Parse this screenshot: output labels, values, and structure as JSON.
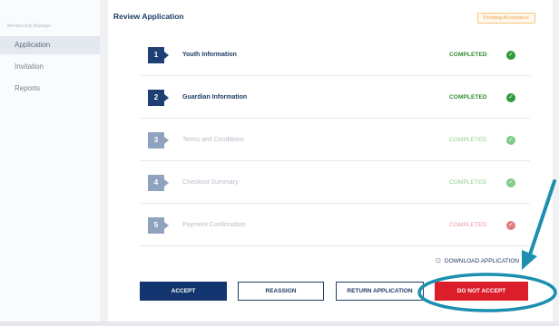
{
  "sidebar": {
    "title": "Membership Manager",
    "items": [
      {
        "label": "Application",
        "active": true
      },
      {
        "label": "Invitation",
        "active": false
      },
      {
        "label": "Reports",
        "active": false
      }
    ]
  },
  "header": {
    "title": "Review Application",
    "badge": "Pending Acceptance"
  },
  "steps": [
    {
      "number": "1",
      "label": "Youth Information",
      "status": "COMPLETED",
      "state": "active"
    },
    {
      "number": "2",
      "label": "Guardian Information",
      "status": "COMPLETED",
      "state": "active"
    },
    {
      "number": "3",
      "label": "Terms and Conditions",
      "status": "COMPLETED",
      "state": "faded"
    },
    {
      "number": "4",
      "label": "Checkout Summary",
      "status": "COMPLETED",
      "state": "faded"
    },
    {
      "number": "5",
      "label": "Payment Confirmation",
      "status": "COMPLETED",
      "state": "faded-error"
    }
  ],
  "download": {
    "label": "DOWNLOAD APPLICATION",
    "icon": "download-icon"
  },
  "actions": {
    "accept": "ACCEPT",
    "reassign": "REASSIGN",
    "return": "RETURN APPLICATION",
    "do_not_accept": "DO NOT ACCEPT"
  },
  "colors": {
    "navy": "#12356f",
    "step_active": "#1d3f73",
    "step_faded": "#8fa3bf",
    "completed_green": "#2f8a2f",
    "faded_green": "#8fcf8f",
    "check_green": "#2f9a3a",
    "check_faded_green": "#7fcc86",
    "check_faded_red": "#e17a82",
    "status_faded_red": "#e99aa0",
    "danger": "#dc1e2b",
    "annotation": "#1b8fb0"
  }
}
